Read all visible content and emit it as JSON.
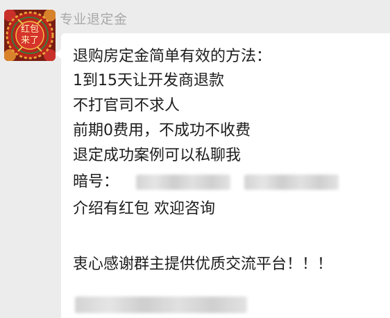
{
  "sender": {
    "name": "专业退定金",
    "avatar_text": "红包来了"
  },
  "message": {
    "lines": [
      "退购房定金简单有效的方法：",
      "1到15天让开发商退款",
      "不打官司不求人",
      "前期0费用，不成功不收费",
      "退定成功案例可以私聊我",
      "暗号：",
      "介绍有红包 欢迎咨询",
      "衷心感谢群主提供优质交流平台！！！"
    ]
  },
  "colors": {
    "background": "#ececec",
    "bubble": "#ffffff",
    "sender_name": "#a9a9a9",
    "avatar_red": "#c0271d",
    "avatar_dark": "#6b1a12"
  }
}
